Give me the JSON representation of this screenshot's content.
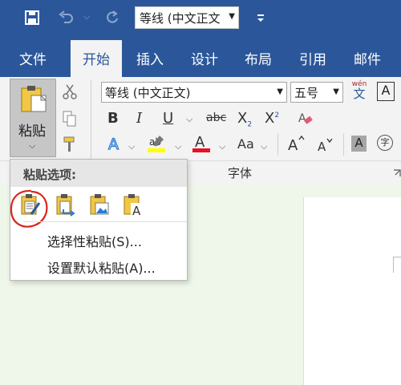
{
  "quick_access": {
    "font_name": "等线 (中文正文"
  },
  "tabs": [
    {
      "label": "文件"
    },
    {
      "label": "开始"
    },
    {
      "label": "插入"
    },
    {
      "label": "设计"
    },
    {
      "label": "布局"
    },
    {
      "label": "引用"
    },
    {
      "label": "邮件"
    }
  ],
  "ribbon": {
    "paste_label": "粘贴",
    "font_name": "等线 (中文正文)",
    "font_size": "五号",
    "phonetic_label": "wén",
    "phonetic_char": "文",
    "font_group_label": "字体",
    "format_buttons": {
      "bold": "B",
      "italic": "I",
      "underline": "U",
      "strike": "abc",
      "subscript": "X",
      "superscript": "X",
      "change_case": "Aa",
      "char_shade": "A",
      "enclosed": "字"
    }
  },
  "paste_menu": {
    "header": "粘贴选项:",
    "options": [
      {
        "name": "keep-source-formatting"
      },
      {
        "name": "merge-formatting"
      },
      {
        "name": "picture"
      },
      {
        "name": "keep-text-only"
      }
    ],
    "items": [
      {
        "label": "选择性粘贴(S)..."
      },
      {
        "label": "设置默认粘贴(A)..."
      }
    ]
  },
  "colors": {
    "title_bar": "#2b579a",
    "ribbon_bg": "#f3f3f3",
    "doc_bg": "#eef7ea",
    "highlight_yellow": "#ffff00",
    "font_color_red": "#e81123",
    "annotation_red": "#d9261c"
  }
}
